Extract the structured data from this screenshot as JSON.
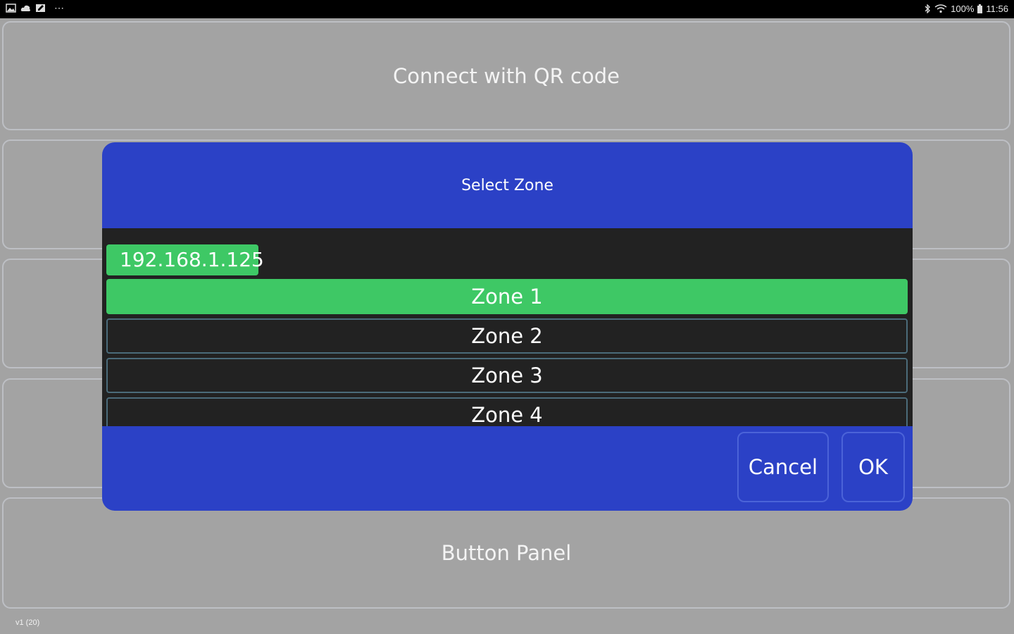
{
  "status_bar": {
    "left_icons": [
      "image-icon",
      "cloud-icon",
      "edit-icon"
    ],
    "overflow": "⋯",
    "battery": "100%",
    "time": "11:56"
  },
  "panels": {
    "top_label": "Connect with QR code",
    "bottom_label": "Button Panel",
    "version": "v1 (20)"
  },
  "dialog": {
    "title": "Select Zone",
    "ip_address": "192.168.1.125",
    "zones": [
      {
        "label": "Zone 1",
        "selected": true
      },
      {
        "label": "Zone 2",
        "selected": false
      },
      {
        "label": "Zone 3",
        "selected": false
      },
      {
        "label": "Zone 4",
        "selected": false
      }
    ],
    "cancel_label": "Cancel",
    "ok_label": "OK"
  },
  "colors": {
    "background": "#a3a3a3",
    "dialog_blue": "#2b41c6",
    "list_dark": "#222222",
    "accent_green": "#3ec865"
  }
}
